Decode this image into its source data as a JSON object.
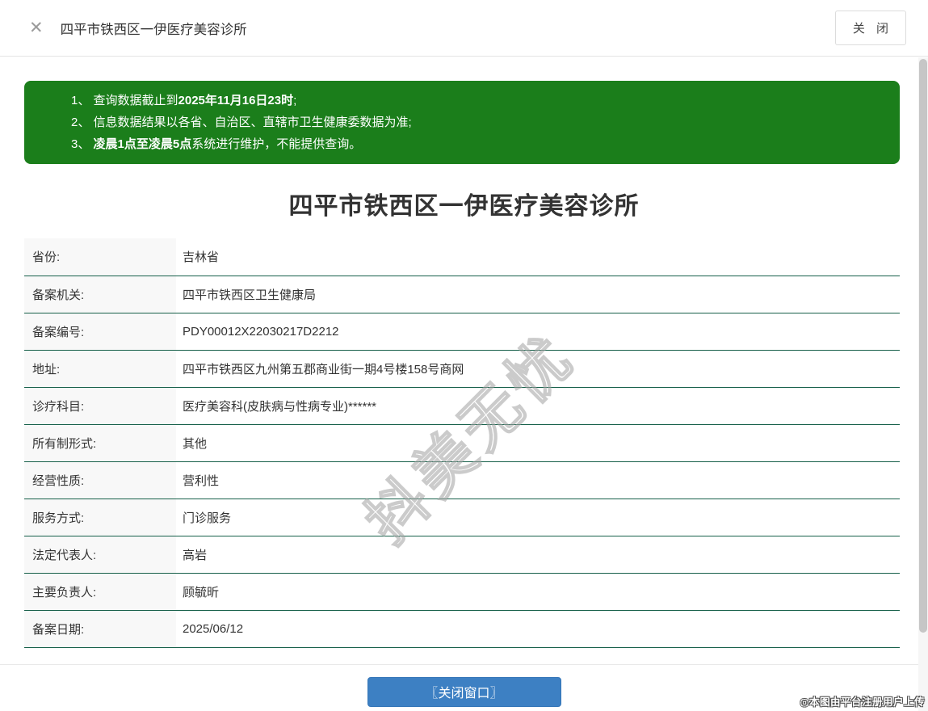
{
  "header": {
    "close_icon": "✕",
    "title": "四平市铁西区一伊医疗美容诊所",
    "close_button_label": "关 闭"
  },
  "notice": {
    "background_color": "#1b7e1b",
    "lines": [
      {
        "parts": [
          {
            "t": "1、 查询数据截止到"
          },
          {
            "t": "2025年11月16日23时"
          },
          {
            "t": ";"
          }
        ]
      },
      {
        "parts": [
          {
            "t": "2、 信息数据结果以各省、自治区、直辖市卫生健康委数据为准;"
          }
        ]
      },
      {
        "parts": [
          {
            "t": "3、 "
          },
          {
            "t": "凌晨1点至凌晨5点"
          },
          {
            "t": "系统进行维护，不能提供查询。"
          }
        ]
      }
    ]
  },
  "main": {
    "title": "四平市铁西区一伊医疗美容诊所"
  },
  "table": {
    "rows": [
      {
        "label": "省份:",
        "value": "吉林省"
      },
      {
        "label": "备案机关:",
        "value": "四平市铁西区卫生健康局"
      },
      {
        "label": "备案编号:",
        "value": "PDY00012X22030217D2212"
      },
      {
        "label": "地址:",
        "value": "四平市铁西区九州第五郡商业街一期4号楼158号商网"
      },
      {
        "label": "诊疗科目:",
        "value": "医疗美容科(皮肤病与性病专业)******"
      },
      {
        "label": "所有制形式:",
        "value": "其他"
      },
      {
        "label": "经营性质:",
        "value": "营利性"
      },
      {
        "label": "服务方式:",
        "value": "门诊服务"
      },
      {
        "label": "法定代表人:",
        "value": "高岩"
      },
      {
        "label": "主要负责人:",
        "value": "顾毓昕"
      },
      {
        "label": "备案日期:",
        "value": "2025/06/12"
      }
    ]
  },
  "watermark": {
    "text": "抖美无忧"
  },
  "footer": {
    "close_window_label": "〖关闭窗口〗",
    "attribution": "◎本图由平台注册用户上传"
  },
  "colors": {
    "notice_green": "#1b7e1b",
    "row_divider_green": "#17604a",
    "button_blue": "#3d80c3"
  }
}
